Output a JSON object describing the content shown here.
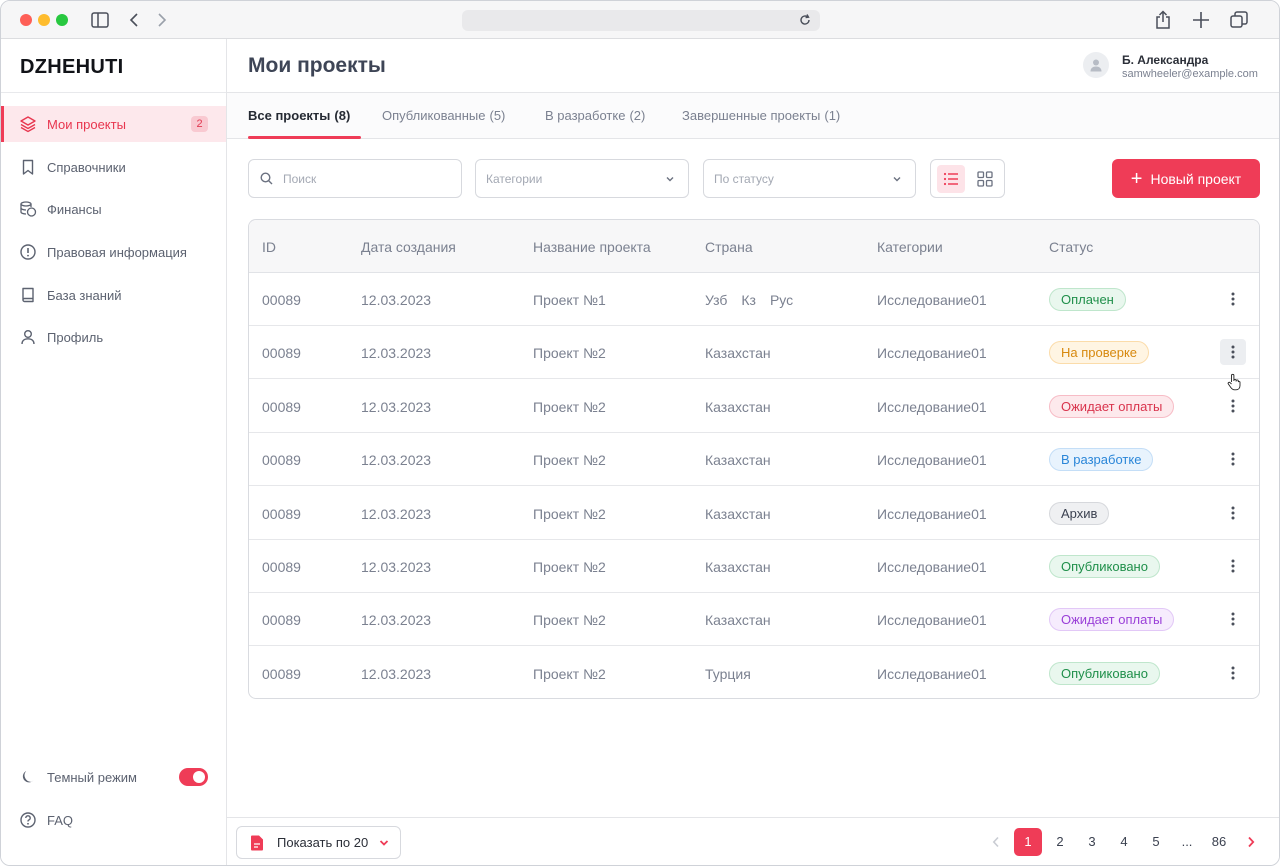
{
  "brand": "DZHEHUTI",
  "header": {
    "title": "Мои проекты",
    "user_name": "Б. Александра",
    "user_email": "samwheeler@example.com"
  },
  "sidebar": {
    "items": [
      {
        "label": "Мои проекты",
        "icon": "layers-icon",
        "badge": "2",
        "active": true
      },
      {
        "label": "Справочники",
        "icon": "bookmark-icon"
      },
      {
        "label": "Финансы",
        "icon": "coins-icon"
      },
      {
        "label": "Правовая информация",
        "icon": "alert-circle-icon"
      },
      {
        "label": "База знаний",
        "icon": "book-icon"
      },
      {
        "label": "Профиль",
        "icon": "user-icon"
      }
    ],
    "dark_mode_label": "Темный режим",
    "dark_mode_on": true,
    "faq_label": "FAQ"
  },
  "tabs": [
    {
      "label": "Все проекты",
      "count": "(8)",
      "active": true
    },
    {
      "label": "Опубликованные",
      "count": "(5)"
    },
    {
      "label": "В разработке",
      "count": "(2)"
    },
    {
      "label": "Завершенные проекты",
      "count": "(1)"
    }
  ],
  "filters": {
    "search_placeholder": "Поиск",
    "category_placeholder": "Категории",
    "status_placeholder": "По статусу",
    "view_mode": "list",
    "new_button_label": "Новый проект"
  },
  "table": {
    "columns": [
      "ID",
      "Дата создания",
      "Название проекта",
      "Страна",
      "Категории",
      "Статус"
    ],
    "rows": [
      {
        "id": "00089",
        "date": "12.03.2023",
        "name": "Проект №1",
        "country": [
          "Узб",
          "Кз",
          "Рус"
        ],
        "category": "Исследование01",
        "status": "Оплачен",
        "status_kind": "paid"
      },
      {
        "id": "00089",
        "date": "12.03.2023",
        "name": "Проект №2",
        "country": [
          "Казахстан"
        ],
        "category": "Исследование01",
        "status": "На проверке",
        "status_kind": "review"
      },
      {
        "id": "00089",
        "date": "12.03.2023",
        "name": "Проект №2",
        "country": [
          "Казахстан"
        ],
        "category": "Исследование01",
        "status": "Ожидает оплаты",
        "status_kind": "awaiting-red"
      },
      {
        "id": "00089",
        "date": "12.03.2023",
        "name": "Проект №2",
        "country": [
          "Казахстан"
        ],
        "category": "Исследование01",
        "status": "В разработке",
        "status_kind": "dev"
      },
      {
        "id": "00089",
        "date": "12.03.2023",
        "name": "Проект №2",
        "country": [
          "Казахстан"
        ],
        "category": "Исследование01",
        "status": "Архив",
        "status_kind": "archive"
      },
      {
        "id": "00089",
        "date": "12.03.2023",
        "name": "Проект №2",
        "country": [
          "Казахстан"
        ],
        "category": "Исследование01",
        "status": "Опубликовано",
        "status_kind": "published"
      },
      {
        "id": "00089",
        "date": "12.03.2023",
        "name": "Проект №2",
        "country": [
          "Казахстан"
        ],
        "category": "Исследование01",
        "status": "Ожидает оплаты",
        "status_kind": "awaiting-purple"
      },
      {
        "id": "00089",
        "date": "12.03.2023",
        "name": "Проект №2",
        "country": [
          "Турция"
        ],
        "category": "Исследование01",
        "status": "Опубликовано",
        "status_kind": "published"
      }
    ]
  },
  "status_colors": {
    "paid": {
      "bg": "#e9f7ee",
      "border": "#bfe6cc",
      "text": "#1f8f4a"
    },
    "review": {
      "bg": "#fff5e3",
      "border": "#fbdcaa",
      "text": "#d7890f"
    },
    "awaiting-red": {
      "bg": "#fde9ec",
      "border": "#f7bcc6",
      "text": "#d9344d"
    },
    "dev": {
      "bg": "#e8f3fd",
      "border": "#c4def7",
      "text": "#2a86d8"
    },
    "archive": {
      "bg": "#eff0f2",
      "border": "#d6d8dc",
      "text": "#3b4150"
    },
    "published": {
      "bg": "#e9f7ee",
      "border": "#bfe6cc",
      "text": "#1f8f4a"
    },
    "awaiting-purple": {
      "bg": "#f6ecfd",
      "border": "#e2c8f7",
      "text": "#9a3fd8"
    }
  },
  "footer": {
    "per_page_label": "Показать по 20",
    "pages": [
      "1",
      "2",
      "3",
      "4",
      "5",
      "...",
      "86"
    ],
    "current_page": "1"
  },
  "accent_color": "#ef3c57"
}
